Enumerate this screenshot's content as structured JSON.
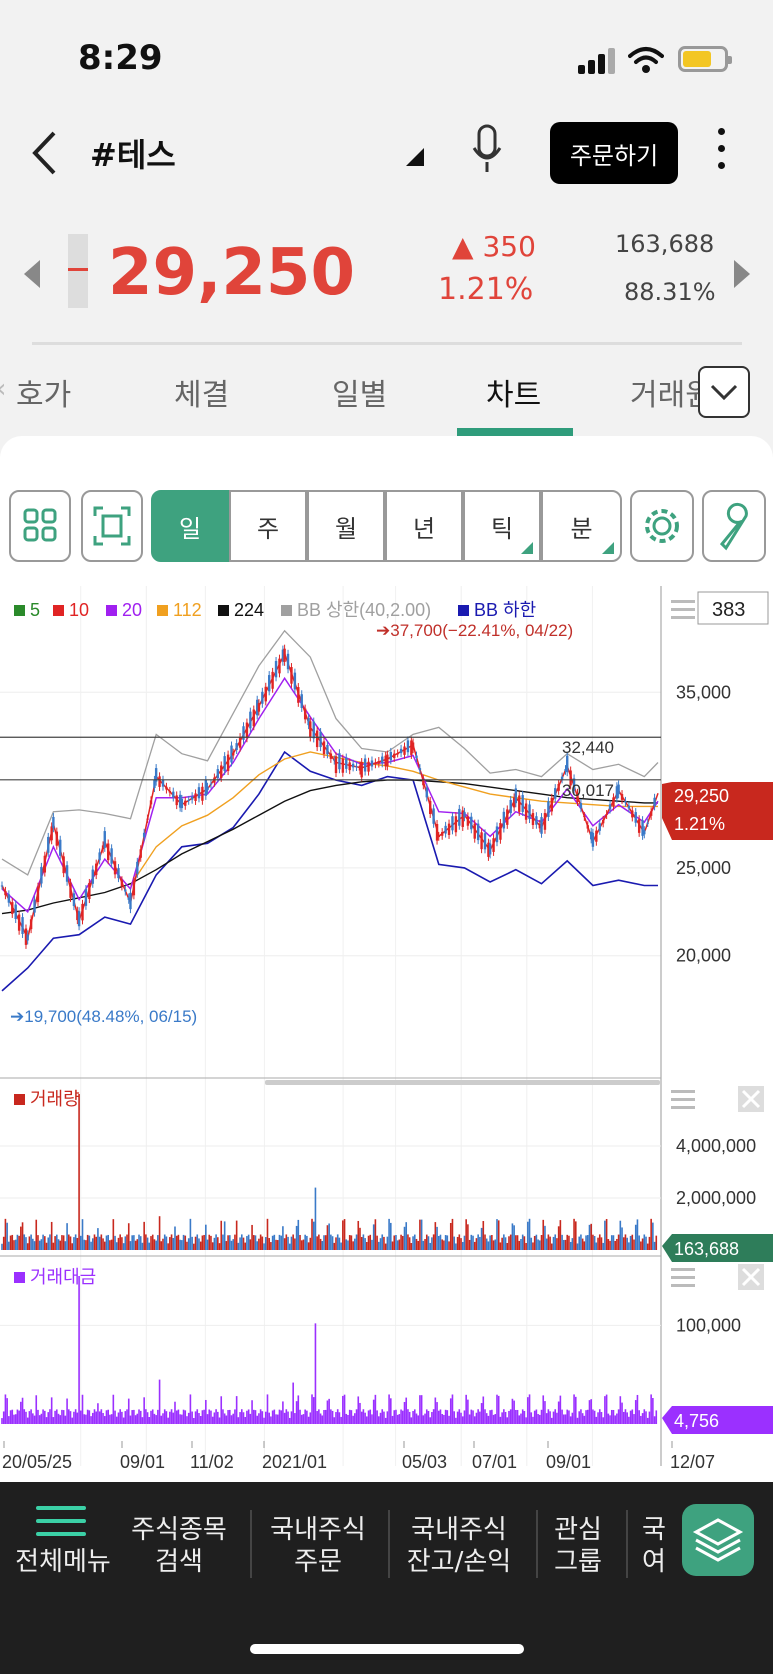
{
  "status_bar": {
    "time": "8:29"
  },
  "header": {
    "title": "#테스",
    "order_button": "주문하기"
  },
  "quote": {
    "price": "29,250",
    "change": "350",
    "change_pct": "1.21%",
    "volume": "163,688",
    "volume_ratio": "88.31%",
    "up_color": "#e0443a"
  },
  "tabs": [
    {
      "label": "호가"
    },
    {
      "label": "체결"
    },
    {
      "label": "일별"
    },
    {
      "label": "차트",
      "active": true
    },
    {
      "label": "거래원"
    }
  ],
  "period_buttons": [
    {
      "label": "일",
      "active": true
    },
    {
      "label": "주"
    },
    {
      "label": "월"
    },
    {
      "label": "년"
    },
    {
      "label": "틱"
    },
    {
      "label": "분"
    }
  ],
  "chart_data": {
    "type": "line",
    "legend": [
      {
        "label": "5",
        "color": "#2a8a2a"
      },
      {
        "label": "10",
        "color": "#e02424"
      },
      {
        "label": "20",
        "color": "#a020f0"
      },
      {
        "label": "112",
        "color": "#f0a020"
      },
      {
        "label": "224",
        "color": "#111111"
      },
      {
        "label": "BB 상한(40,2.00)",
        "color": "#a0a0a0"
      },
      {
        "label": "BB 하한",
        "color": "#1a1ab0"
      }
    ],
    "bars_count": "383",
    "high_annotation": "37,700(−22.41%, 04/22)",
    "low_annotation": "19,700(48.48%, 06/15)",
    "ylim": [
      16000,
      39000
    ],
    "y_ticks": [
      "35,000",
      "25,000",
      "20,000"
    ],
    "y_tick_values": [
      35000,
      25000,
      20000
    ],
    "hlines": [
      {
        "value": 32440,
        "label": "32,440"
      },
      {
        "value": 30017,
        "label": "30,017"
      }
    ],
    "current": {
      "value": 29250,
      "label": "29,250",
      "pct": "1.21%"
    },
    "x_labels": [
      "20/05/25",
      "09/01",
      "11/02",
      "2021/01",
      "05/03",
      "07/01",
      "09/01",
      "12/07"
    ],
    "price_series": {
      "x": [
        0,
        15,
        30,
        45,
        60,
        75,
        90,
        105,
        120,
        135,
        150,
        165,
        180,
        195,
        210,
        225,
        240,
        255,
        270,
        285,
        300,
        315,
        330,
        345,
        360,
        375,
        383
      ],
      "close": [
        24000,
        21000,
        27500,
        22000,
        26500,
        23000,
        30200,
        28600,
        29500,
        31500,
        34200,
        37200,
        33000,
        31000,
        30700,
        31200,
        32000,
        26800,
        28000,
        26000,
        29000,
        27300,
        30800,
        26500,
        29400,
        27000,
        29250
      ],
      "ma20": [
        23800,
        22500,
        26200,
        23200,
        25500,
        23800,
        29000,
        29000,
        29200,
        31000,
        33500,
        35800,
        33600,
        31500,
        30900,
        31000,
        31400,
        28200,
        28100,
        26800,
        28200,
        27600,
        29500,
        27400,
        28600,
        27600,
        28800
      ],
      "ma112": [
        null,
        null,
        null,
        null,
        null,
        24000,
        26200,
        27400,
        28000,
        29000,
        30300,
        31200,
        31600,
        31300,
        31000,
        30800,
        30500,
        30000,
        29600,
        29200,
        29000,
        28800,
        28700,
        28600,
        28500,
        28500,
        28500
      ],
      "ma224": [
        22400,
        22600,
        23000,
        23300,
        23600,
        24100,
        24900,
        25800,
        26500,
        27200,
        28000,
        28800,
        29400,
        29700,
        29900,
        30000,
        30000,
        29900,
        29800,
        29600,
        29400,
        29200,
        29000,
        28900,
        28800,
        28700,
        28700
      ],
      "bb_upper": [
        25500,
        24600,
        28200,
        28300,
        28100,
        27800,
        32600,
        31500,
        31100,
        33800,
        36500,
        38500,
        37000,
        33500,
        31800,
        31600,
        32600,
        33000,
        31800,
        30400,
        30600,
        30200,
        31500,
        30600,
        30900,
        30200,
        31000
      ],
      "bb_lower": [
        18000,
        19300,
        21000,
        21200,
        22200,
        21800,
        24600,
        26200,
        26400,
        27300,
        29200,
        31600,
        30500,
        30000,
        29700,
        30200,
        30000,
        25200,
        25000,
        24200,
        24900,
        24100,
        25400,
        24000,
        24300,
        24000,
        24000
      ]
    },
    "volume_panel": {
      "title": "거래량",
      "ylim": [
        0,
        6000000
      ],
      "y_ticks": [
        "4,000,000",
        "2,000,000"
      ],
      "y_tick_values": [
        4000000,
        2000000
      ],
      "current_label": "163,688",
      "spikes": [
        {
          "x": 45,
          "value": 6000000
        },
        {
          "x": 183,
          "value": 2400000
        },
        {
          "x": 92,
          "value": 1300000
        },
        {
          "x": 130,
          "value": 1100000
        }
      ]
    },
    "value_panel": {
      "title": "거래대금",
      "ylim": [
        0,
        150000
      ],
      "y_ticks": [
        "100,000"
      ],
      "y_tick_values": [
        100000
      ],
      "current_label": "4,756",
      "spikes": [
        {
          "x": 45,
          "value": 150000
        },
        {
          "x": 183,
          "value": 102000
        },
        {
          "x": 92,
          "value": 45000
        },
        {
          "x": 170,
          "value": 42000
        }
      ]
    }
  },
  "bottom_nav": [
    {
      "line1": "전체메뉴",
      "line2": ""
    },
    {
      "line1": "주식종목",
      "line2": "검색"
    },
    {
      "line1": "국내주식",
      "line2": "주문"
    },
    {
      "line1": "국내주식",
      "line2": "잔고/손익"
    },
    {
      "line1": "관심",
      "line2": "그룹"
    },
    {
      "line1": "국",
      "line2": "여"
    }
  ],
  "accent_color": "#3ea27f"
}
